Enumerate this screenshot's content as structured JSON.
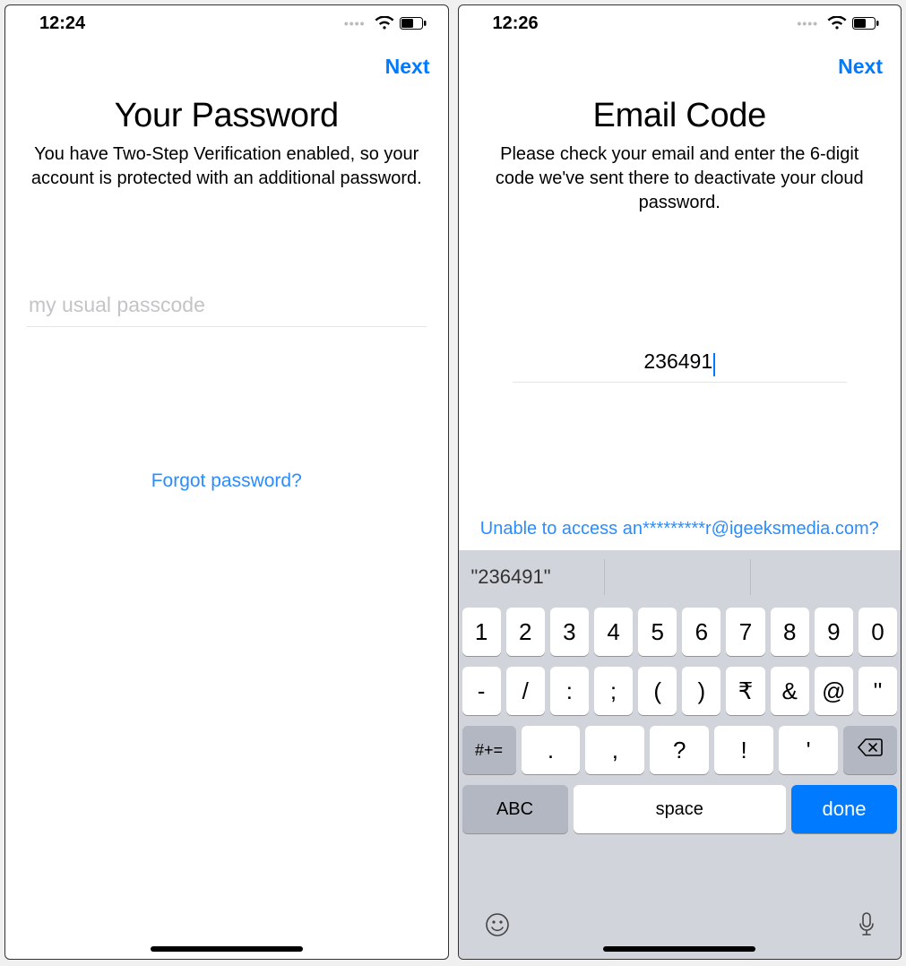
{
  "left": {
    "status_time": "12:24",
    "nav_next": "Next",
    "title": "Your Password",
    "subtitle": "You have Two-Step Verification enabled, so your account is protected with an additional password.",
    "password_placeholder": "my usual passcode",
    "forgot_link": "Forgot password?"
  },
  "right": {
    "status_time": "12:26",
    "nav_next": "Next",
    "title": "Email Code",
    "subtitle": "Please check your email and enter the 6-digit code we've sent there to deactivate your cloud password.",
    "code_value": "236491",
    "unable_link": "Unable to access an*********r@igeeksmedia.com?",
    "keyboard": {
      "suggestion": "\"236491\"",
      "row1": [
        "1",
        "2",
        "3",
        "4",
        "5",
        "6",
        "7",
        "8",
        "9",
        "0"
      ],
      "row2": [
        "-",
        "/",
        ":",
        ";",
        "(",
        ")",
        "₹",
        "&",
        "@",
        "''"
      ],
      "row3_shift": "#+=",
      "row3": [
        ".",
        ",",
        "?",
        "!",
        "'"
      ],
      "abc": "ABC",
      "space": "space",
      "done": "done"
    }
  }
}
